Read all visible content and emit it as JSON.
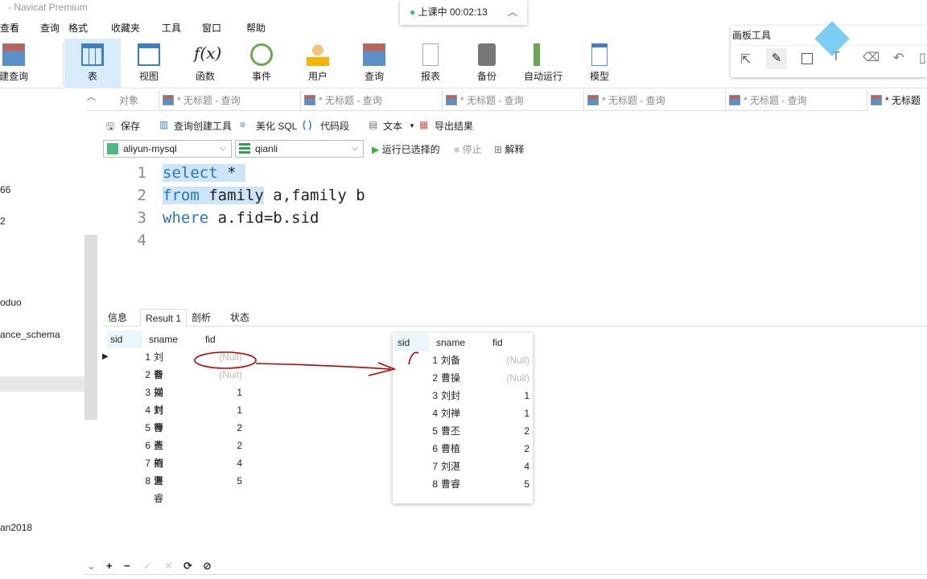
{
  "window": {
    "title": "- Navicat Premium"
  },
  "menu": [
    "查看",
    "查询",
    "格式",
    "收藏夹",
    "工具",
    "窗口",
    "帮助"
  ],
  "ribbon": [
    {
      "label": "建查询",
      "icon": "new-query-icon"
    },
    {
      "label": "表",
      "icon": "table-icon",
      "active": true
    },
    {
      "label": "视图",
      "icon": "view-icon"
    },
    {
      "label": "函数",
      "icon": "function-icon"
    },
    {
      "label": "事件",
      "icon": "event-clock-icon"
    },
    {
      "label": "用户",
      "icon": "user-icon"
    },
    {
      "label": "查询",
      "icon": "query-icon"
    },
    {
      "label": "报表",
      "icon": "report-icon"
    },
    {
      "label": "备份",
      "icon": "backup-icon"
    },
    {
      "label": "自动运行",
      "icon": "automation-icon"
    },
    {
      "label": "模型",
      "icon": "model-icon"
    }
  ],
  "class_badge": {
    "status": "上课中",
    "timer": "00:02:13"
  },
  "painter": {
    "title": "画板工具",
    "tools": [
      "select",
      "pen",
      "rectangle",
      "text",
      "eraser",
      "undo",
      "delete"
    ]
  },
  "tabs": {
    "objects": "对象",
    "query_tabs": [
      "* 无标题 - 查询",
      "* 无标题 - 查询",
      "* 无标题 - 查询",
      "* 无标题 - 查询",
      "* 无标题 - 查询",
      "* 无标题"
    ]
  },
  "toolbar": {
    "save": "保存",
    "query_builder": "查询创建工具",
    "beautify": "美化 SQL",
    "snippet": "代码段",
    "text": "文本",
    "export": "导出结果",
    "run_selected": "运行已选择的",
    "stop": "停止",
    "explain": "解释"
  },
  "connection": {
    "server": "aliyun-mysql",
    "database": "qianli"
  },
  "editor": {
    "line_numbers": [
      "1",
      "2",
      "3",
      "4"
    ],
    "lines": [
      "select *",
      "from family a,family b",
      "where a.fid=b.sid",
      ""
    ]
  },
  "sidebar": {
    "items": [
      "66",
      "2",
      "oduo",
      "ance_schema",
      "an2018"
    ]
  },
  "result_tabs": [
    "信息",
    "Result 1",
    "剖析",
    "状态"
  ],
  "result": {
    "columns": [
      "sid",
      "sname",
      "fid"
    ],
    "rows": [
      [
        "1",
        "刘备",
        "(Null)"
      ],
      [
        "2",
        "曹操",
        "(Null)"
      ],
      [
        "3",
        "刘封",
        "1"
      ],
      [
        "4",
        "刘禅",
        "1"
      ],
      [
        "5",
        "曹丕",
        "2"
      ],
      [
        "6",
        "曹植",
        "2"
      ],
      [
        "7",
        "刘湛",
        "4"
      ],
      [
        "8",
        "曹睿",
        "5"
      ]
    ]
  },
  "bottom_bar": [
    "+",
    "−",
    "✓",
    "✕",
    "⟳",
    "⊘"
  ]
}
